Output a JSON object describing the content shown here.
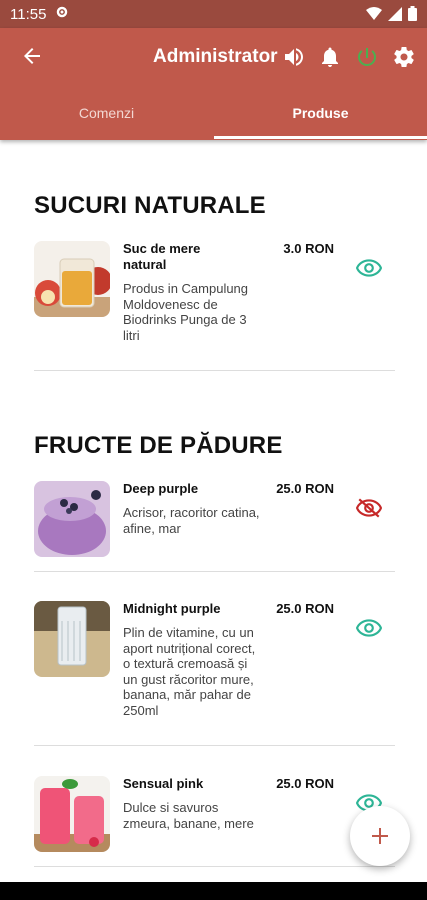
{
  "status": {
    "time": "11:55"
  },
  "header": {
    "title": "Administrator"
  },
  "tabs": [
    {
      "label": "Comenzi"
    },
    {
      "label": "Produse"
    }
  ],
  "sections": [
    {
      "title": "SUCURI NATURALE",
      "items": [
        {
          "name": "Suc de mere natural",
          "price": "3.0 RON",
          "description": "Produs in Campulung Moldovenesc de Biodrinks Punga de 3 litri",
          "visible": true
        }
      ]
    },
    {
      "title": "FRUCTE DE PĂDURE",
      "items": [
        {
          "name": "Deep purple",
          "price": "25.0 RON",
          "description": "Acrisor, racoritor catina, afine, mar",
          "visible": false
        },
        {
          "name": "Midnight purple",
          "price": "25.0 RON",
          "description": "Plin de vitamine, cu un aport nutrițional corect, o textură cremoasă și un gust răcoritor mure, banana, măr pahar de 250ml",
          "visible": true
        },
        {
          "name": "Sensual pink",
          "price": "25.0 RON",
          "description": "Dulce si savuros zmeura, banane, mere",
          "visible": true
        }
      ]
    }
  ],
  "colors": {
    "appbar": "#c0594b",
    "statusbar": "#9a4a3e",
    "eye_visible": "#2db596",
    "eye_hidden": "#c62828",
    "fab_plus": "#c0594b"
  }
}
